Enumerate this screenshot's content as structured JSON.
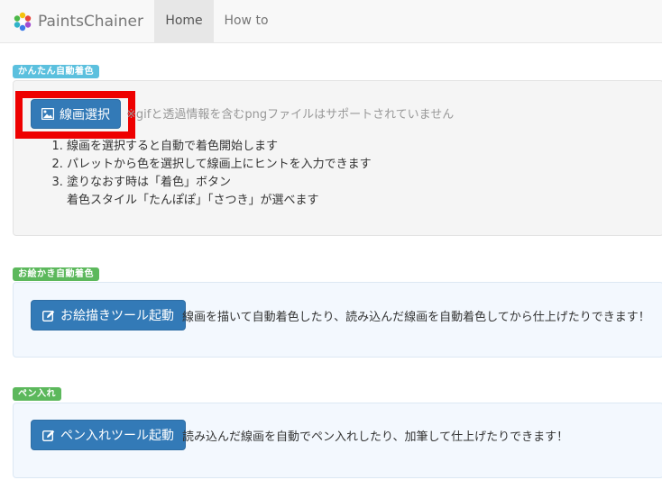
{
  "navbar": {
    "brand": "PaintsChainer",
    "logo_icon": "flower-logo-icon",
    "items": [
      {
        "label": "Home",
        "active": true
      },
      {
        "label": "How to",
        "active": false
      }
    ]
  },
  "auto": {
    "label": "かんたん自動着色",
    "button_label": "線画選択",
    "button_icon": "image-icon",
    "note": "※gifと透過情報を含むpngファイルはサポートされていません",
    "steps": [
      "線画を選択すると自動で着色開始します",
      "パレットから色を選択して線画上にヒントを入力できます",
      "塗りなおす時は「着色」ボタン"
    ],
    "step3_sub": "着色スタイル「たんぽぽ」「さつき」が選べます"
  },
  "drawing": {
    "label": "お絵かき自動着色",
    "button_label": "お絵描きツール起動",
    "button_icon": "edit-icon",
    "description": "線画を描いて自動着色したり、読み込んだ線画を自動着色してから仕上げたりできます！"
  },
  "inking": {
    "label": "ペン入れ",
    "button_label": "ペン入れツール起動",
    "button_icon": "edit-icon",
    "description": "読み込んだ線画を自動でペン入れしたり、加筆して仕上げたりできます！"
  },
  "colors": {
    "primary": "#337ab7",
    "info": "#5bc0de",
    "success": "#5cb85c",
    "highlight": "#ee0000"
  }
}
